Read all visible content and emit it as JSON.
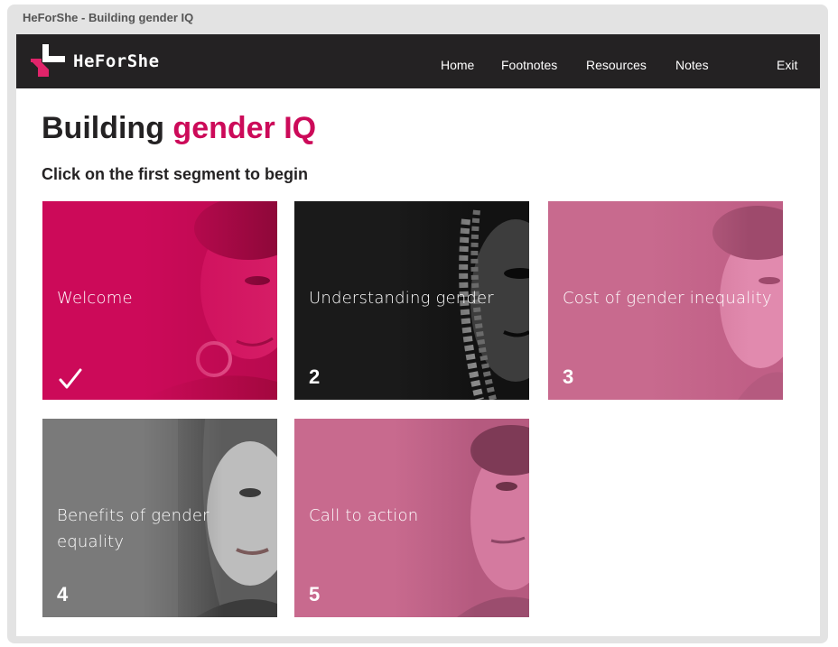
{
  "window": {
    "title": "HeForShe - Building gender IQ"
  },
  "nav": {
    "brand": "HeForShe",
    "links": [
      "Home",
      "Footnotes",
      "Resources",
      "Notes",
      "Exit"
    ]
  },
  "page": {
    "title_plain": "Building",
    "title_accent": "gender IQ",
    "instruction": "Click on the first segment to begin"
  },
  "segments": [
    {
      "title": "Welcome",
      "number": "",
      "completed": true,
      "color": "#cc0a59"
    },
    {
      "title": "Understanding gender",
      "number": "2",
      "completed": false,
      "color": "#1a1a1a"
    },
    {
      "title": "Cost of gender inequality",
      "number": "3",
      "completed": false,
      "color": "#c86a8e"
    },
    {
      "title": "Benefits of gender equality",
      "number": "4",
      "completed": false,
      "color": "#7a7a7a"
    },
    {
      "title": "Call to action",
      "number": "5",
      "completed": false,
      "color": "#c86a8e"
    }
  ],
  "colors": {
    "accent": "#cc0a59",
    "nav_bg": "#242223",
    "text_dark": "#242223"
  },
  "icons": [
    "heforshe-logo-icon",
    "checkmark-icon"
  ]
}
